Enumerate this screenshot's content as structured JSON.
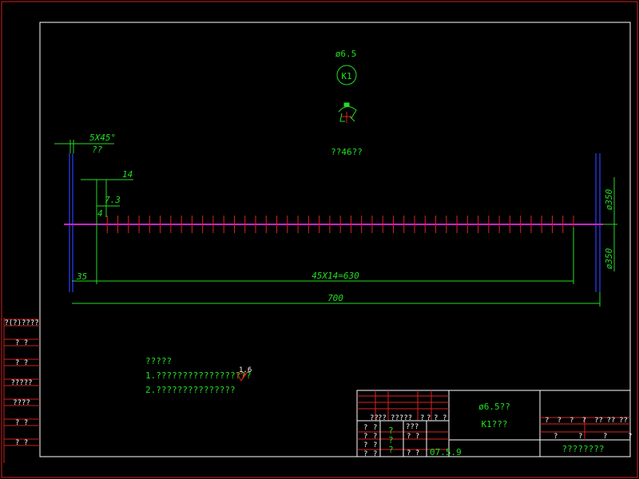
{
  "colors": {
    "background": "#000000",
    "frame": "#ffffff",
    "border": "#cc2222",
    "dimension": "#22dd22",
    "rod": "#2233cc",
    "axis": "#cc22cc",
    "tick": "#dd2222"
  },
  "header": {
    "diameter": "ø6.5",
    "mark": "K1",
    "count_label": "??46??"
  },
  "dimensions": {
    "chamfer": "5X45°",
    "chamfer_note": "??",
    "pitch_start": "14",
    "offset": "7.3",
    "small": "4",
    "left_end": "35",
    "spacing": "45X14=630",
    "total": "700",
    "dia_top": "ø350",
    "dia_bottom": "ø350"
  },
  "notes": {
    "title": "?????",
    "line1": "1.??????????????????",
    "roughness": "1.6",
    "line2": "2.???????????????"
  },
  "side_column": [
    "?(?)????",
    "?  ?",
    "?  ?",
    "?????",
    "????",
    "?  ?",
    "?  ?"
  ],
  "title_block": {
    "header_cells": [
      "??",
      "??",
      "?????",
      "?",
      "?",
      "?",
      "?"
    ],
    "left_rows": [
      [
        "?",
        "?"
      ],
      [
        "?",
        "?"
      ],
      [
        "?",
        "?"
      ],
      [
        "?",
        "?"
      ]
    ],
    "mid_marks": [
      "?",
      "?",
      "?"
    ],
    "right_cells": [
      "???",
      "? ?",
      "? ?"
    ],
    "date": "07.5.9",
    "part_name": "ø6.5??",
    "part_code": "K1???",
    "right_header": [
      "?",
      "?",
      "?",
      "?",
      "??",
      "??",
      "??"
    ],
    "right_row": [
      "?",
      "?",
      "?",
      "?"
    ],
    "company": "????????"
  }
}
